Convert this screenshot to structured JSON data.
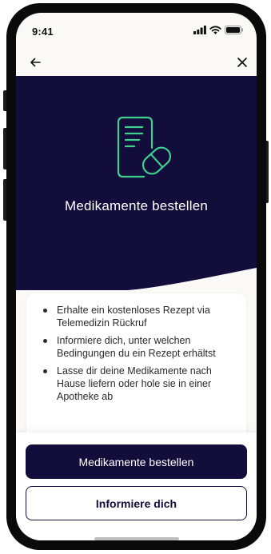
{
  "status_bar": {
    "time": "9:41",
    "icons": [
      "signal-icon",
      "wifi-icon",
      "battery-icon"
    ]
  },
  "nav": {
    "back_icon": "arrow-left-icon",
    "close_icon": "close-icon"
  },
  "hero": {
    "icon": "prescription-pill-icon",
    "title": "Medikamente bestellen",
    "background_color": "#120d3a",
    "accent_color": "#3ecf8e"
  },
  "benefits": [
    "Erhalte ein kostenloses Rezept via Telemedizin Rückruf",
    "Informiere dich, unter welchen Bedingungen du ein Rezept erhältst",
    "Lasse dir deine Medikamente nach Hause liefern oder hole sie in einer Apotheke ab"
  ],
  "actions": {
    "primary_label": "Medikamente bestellen",
    "secondary_label": "Informiere dich"
  }
}
